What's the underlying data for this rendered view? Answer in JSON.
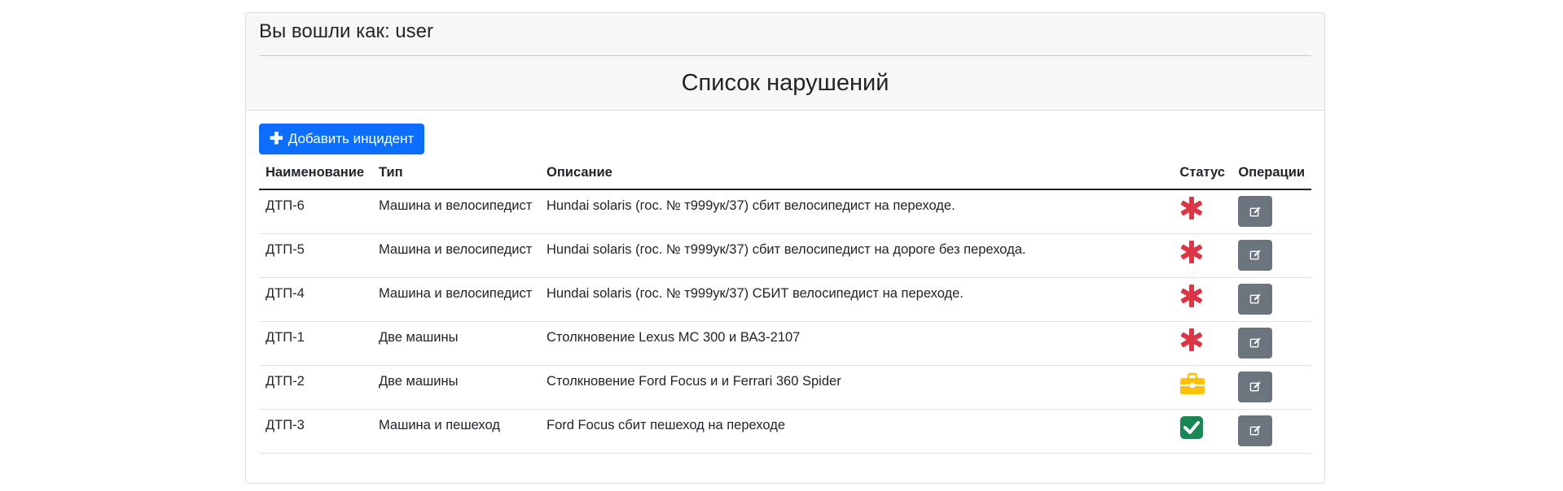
{
  "header": {
    "user_text": "Вы вошли как: user",
    "title": "Список нарушений"
  },
  "toolbar": {
    "add_label": "Добавить инцидент",
    "add_icon": "plus-icon"
  },
  "table": {
    "columns": [
      "Наименование",
      "Тип",
      "Описание",
      "Статус",
      "Операции"
    ],
    "rows": [
      {
        "name": "ДТП-6",
        "type": "Машина и велосипедист",
        "description": "Hundai solaris (гос. № т999ук/37) сбит велосипедист на переходе.",
        "status_icon": "asterisk-icon"
      },
      {
        "name": "ДТП-5",
        "type": "Машина и велосипедист",
        "description": "Hundai solaris (гос. № т999ук/37) сбит велосипедист на дороге без перехода.",
        "status_icon": "asterisk-icon"
      },
      {
        "name": "ДТП-4",
        "type": "Машина и велосипедист",
        "description": "Hundai solaris (гос. № т999ук/37) СБИТ велосипедист на переходе.",
        "status_icon": "asterisk-icon"
      },
      {
        "name": "ДТП-1",
        "type": "Две машины",
        "description": "Столкновение Lexus MC 300 и ВАЗ-2107",
        "status_icon": "asterisk-icon"
      },
      {
        "name": "ДТП-2",
        "type": "Две машины",
        "description": "Столкновение Ford Focus и и Ferrari 360 Spider",
        "status_icon": "briefcase-icon"
      },
      {
        "name": "ДТП-3",
        "type": "Машина и пешеход",
        "description": "Ford Focus сбит пешеход на переходе",
        "status_icon": "check-square-icon"
      }
    ]
  },
  "colors": {
    "primary": "#0d6efd",
    "secondary": "#6c757d",
    "danger": "#dc3545",
    "warning": "#ffc107",
    "success": "#198754"
  }
}
